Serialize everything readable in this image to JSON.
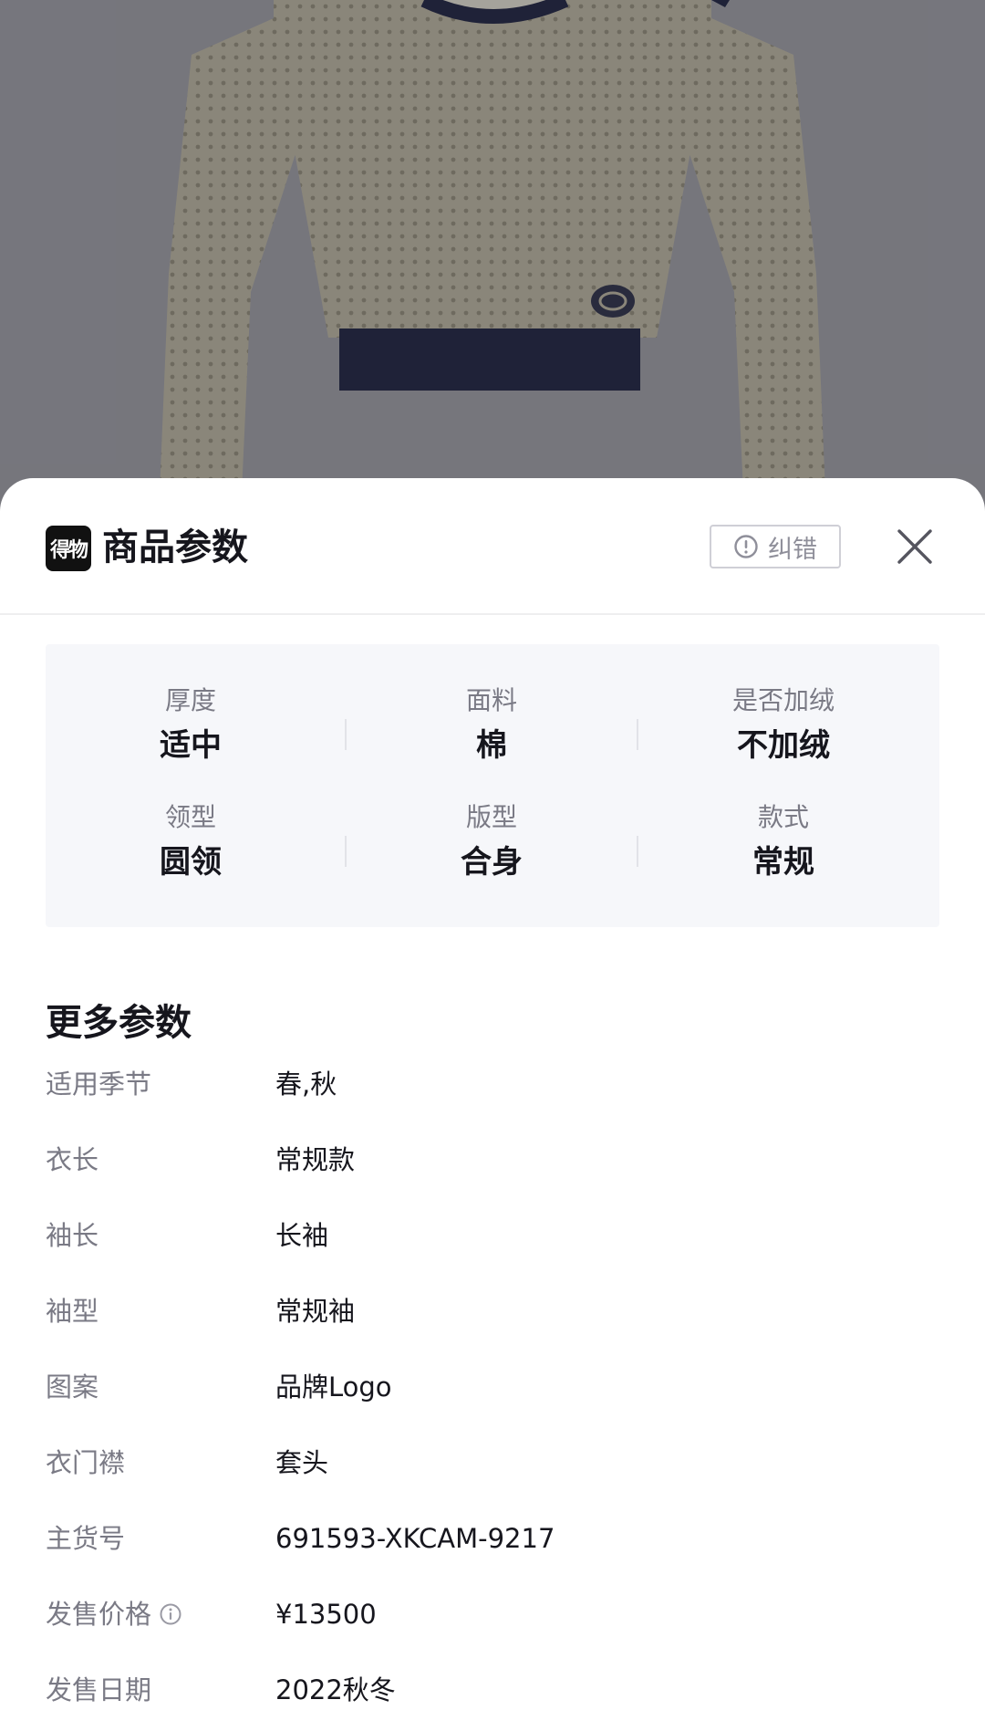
{
  "sheet": {
    "title": "商品参数",
    "logo_text": "得物",
    "report_label": "纠错"
  },
  "key_params": [
    {
      "label": "厚度",
      "value": "适中"
    },
    {
      "label": "面料",
      "value": "棉"
    },
    {
      "label": "是否加绒",
      "value": "不加绒"
    },
    {
      "label": "领型",
      "value": "圆领"
    },
    {
      "label": "版型",
      "value": "合身"
    },
    {
      "label": "款式",
      "value": "常规"
    }
  ],
  "more_params": {
    "title": "更多参数",
    "rows": [
      {
        "label": "适用季节",
        "value": "春,秋"
      },
      {
        "label": "衣长",
        "value": "常规款"
      },
      {
        "label": "袖长",
        "value": "长袖"
      },
      {
        "label": "袖型",
        "value": "常规袖"
      },
      {
        "label": "图案",
        "value": "品牌Logo"
      },
      {
        "label": "衣门襟",
        "value": "套头"
      },
      {
        "label": "主货号",
        "value": "691593-XKCAM-9217"
      },
      {
        "label": "发售价格",
        "value": "¥13500"
      },
      {
        "label": "发售日期",
        "value": "2022秋冬"
      }
    ]
  },
  "colors": {
    "overlay": "#8d8d92",
    "sweater_body": "#b9b39e",
    "sweater_trim": "#1b1f3d",
    "params_bg": "#f6f7fa"
  }
}
